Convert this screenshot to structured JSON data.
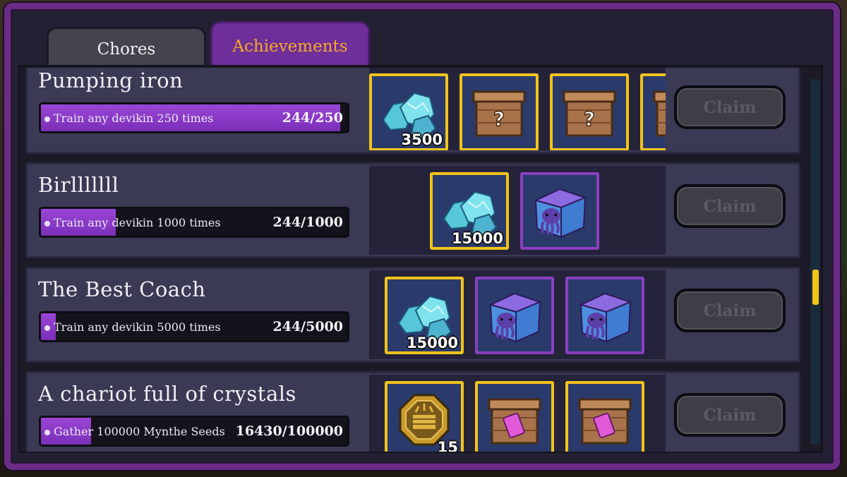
{
  "tabs": [
    {
      "label": "Chores",
      "active": false
    },
    {
      "label": "Achievements",
      "active": true
    }
  ],
  "achievements": [
    {
      "title": "Pumping iron",
      "description": "Train any devikin 250 times",
      "count": "244/250",
      "progress_fraction": 0.976,
      "rewards": [
        {
          "icon": "crystal-icon",
          "count": "3500",
          "border": "#f2c31a"
        },
        {
          "icon": "mystery-crate-icon",
          "count": "",
          "border": "#f2c31a"
        },
        {
          "icon": "mystery-crate-icon",
          "count": "",
          "border": "#f2c31a"
        },
        {
          "icon": "mystery-crate-icon",
          "count": "",
          "border": "#f2c31a"
        }
      ],
      "claim_label": "Claim"
    },
    {
      "title": "Birlllllll",
      "description": "Train any devikin 1000 times",
      "count": "244/1000",
      "progress_fraction": 0.244,
      "rewards": [
        {
          "icon": "crystal-icon",
          "count": "15000",
          "border": "#f2c31a"
        },
        {
          "icon": "octopus-box-icon",
          "count": "",
          "border": "#8a3fc0"
        }
      ],
      "claim_label": "Claim"
    },
    {
      "title": "The Best Coach",
      "description": "Train any devikin 5000 times",
      "count": "244/5000",
      "progress_fraction": 0.049,
      "rewards": [
        {
          "icon": "crystal-icon",
          "count": "15000",
          "border": "#f2c31a"
        },
        {
          "icon": "octopus-box-icon",
          "count": "",
          "border": "#8a3fc0"
        },
        {
          "icon": "octopus-box-icon",
          "count": "",
          "border": "#8a3fc0"
        }
      ],
      "claim_label": "Claim"
    },
    {
      "title": "A chariot full of crystals",
      "description": "Gather 100000 Mynthe Seeds",
      "count": "16430/100000",
      "progress_fraction": 0.164,
      "rewards": [
        {
          "icon": "gold-medallion-icon",
          "count": "15",
          "border": "#f2c31a"
        },
        {
          "icon": "ticket-crate-icon",
          "count": "",
          "border": "#f2c31a"
        },
        {
          "icon": "ticket-crate-icon",
          "count": "",
          "border": "#f2c31a"
        }
      ],
      "claim_label": "Claim"
    }
  ],
  "colors": {
    "frame": "#6a2c86",
    "active_tab": "#6e2f9a",
    "active_tab_text": "#f7a826",
    "progress_fill": "#8a3cc8",
    "reward_border_gold": "#f2c31a",
    "reward_border_purple": "#8a3fc0",
    "scroll_thumb": "#f3c316"
  }
}
